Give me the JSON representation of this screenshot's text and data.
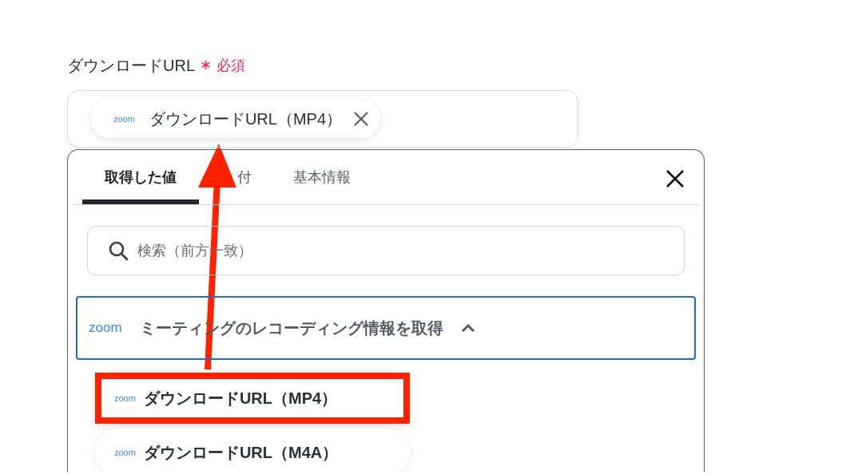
{
  "field": {
    "label": "ダウンロードURL",
    "required_mark": "∗",
    "required_text": "必須",
    "chip": {
      "logo": "zoom",
      "text": "ダウンロードURL（MP4）"
    }
  },
  "panel": {
    "tabs": [
      {
        "label": "取得した値",
        "selected": true
      },
      {
        "label": "付",
        "selected": false
      },
      {
        "label": "基本情報",
        "selected": false
      }
    ],
    "search": {
      "placeholder": "検索（前方一致）"
    },
    "group": {
      "logo": "zoom",
      "title": "ミーティングのレコーディング情報を取得",
      "expanded": true,
      "items": [
        {
          "logo": "zoom",
          "label": "ダウンロードURL（MP4）",
          "highlighted": true
        },
        {
          "logo": "zoom",
          "label": "ダウンロードURL（M4A）",
          "highlighted": false
        }
      ]
    }
  }
}
